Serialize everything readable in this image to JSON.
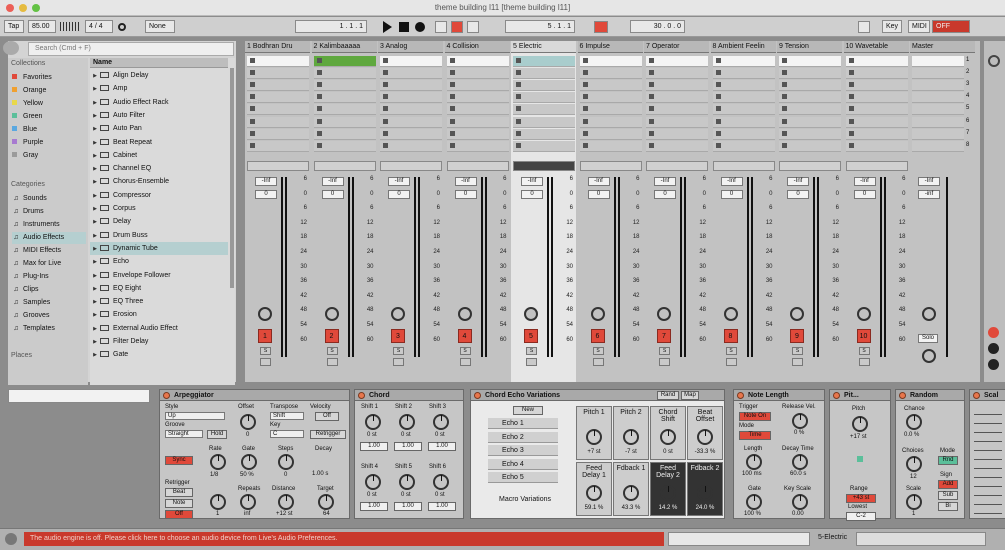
{
  "window": {
    "title": "theme building l11  [theme building l11]"
  },
  "control_bar": {
    "tap": "Tap",
    "tempo": "85.00",
    "time_sig": "4 / 4",
    "metronome": "1 Bar",
    "quantize": "None",
    "position": "1 .  1 .  1",
    "loop_start": "5 .  1 .  1",
    "loop_length": "30 .  0 .  0",
    "key_label": "Key",
    "midi_label": "MIDI",
    "cpu": "OFF"
  },
  "browser": {
    "search_placeholder": "Search (Cmd + F)",
    "collections_header": "Collections",
    "collections": [
      {
        "label": "Favorites",
        "color": "#e0493a"
      },
      {
        "label": "Orange",
        "color": "#f0a030"
      },
      {
        "label": "Yellow",
        "color": "#e8d84a"
      },
      {
        "label": "Green",
        "color": "#5bbf9a"
      },
      {
        "label": "Blue",
        "color": "#5aa8e0"
      },
      {
        "label": "Purple",
        "color": "#a77ad0"
      },
      {
        "label": "Gray",
        "color": "#9a9a9a"
      }
    ],
    "categories_header": "Categories",
    "categories": [
      "Sounds",
      "Drums",
      "Instruments",
      "Audio Effects",
      "MIDI Effects",
      "Max for Live",
      "Plug-Ins",
      "Clips",
      "Samples",
      "Grooves",
      "Templates"
    ],
    "places_header": "Places",
    "name_header": "Name",
    "items": [
      "Align Delay",
      "Amp",
      "Audio Effect Rack",
      "Auto Filter",
      "Auto Pan",
      "Beat Repeat",
      "Cabinet",
      "Channel EQ",
      "Chorus-Ensemble",
      "Compressor",
      "Corpus",
      "Delay",
      "Drum Buss",
      "Dynamic Tube",
      "Echo",
      "Envelope Follower",
      "EQ Eight",
      "EQ Three",
      "Erosion",
      "External Audio Effect",
      "Filter Delay",
      "Gate"
    ]
  },
  "tracks": [
    {
      "name": "1 Bodhran Dru",
      "num": "1",
      "vol": "-Inf",
      "send": "0"
    },
    {
      "name": "2 Kalimbaaaaa",
      "num": "2",
      "vol": "-Inf",
      "send": "0"
    },
    {
      "name": "3 Analog",
      "num": "3",
      "vol": "-Inf",
      "send": "0"
    },
    {
      "name": "4 Collision",
      "num": "4",
      "vol": "-Inf",
      "send": "0"
    },
    {
      "name": "5 Electric",
      "num": "5",
      "vol": "-Inf",
      "send": "0"
    },
    {
      "name": "6 Impulse",
      "num": "6",
      "vol": "-Inf",
      "send": "0"
    },
    {
      "name": "7 Operator",
      "num": "7",
      "vol": "-Inf",
      "send": "0"
    },
    {
      "name": "8 Ambient Feelin",
      "num": "8",
      "vol": "-Inf",
      "send": "0"
    },
    {
      "name": "9 Tension",
      "num": "9",
      "vol": "-Inf",
      "send": "0"
    },
    {
      "name": "10 Wavetable",
      "num": "10",
      "vol": "-Inf",
      "send": "0"
    }
  ],
  "master": {
    "name": "Master",
    "vol": "-Inf",
    "send": "-inf",
    "solo": "Solo",
    "scenes": [
      "1",
      "2",
      "3",
      "4",
      "5",
      "6",
      "7",
      "8"
    ]
  },
  "db_scale": [
    "6",
    "0",
    "6",
    "12",
    "18",
    "24",
    "30",
    "36",
    "42",
    "48",
    "54",
    "60"
  ],
  "devices": {
    "arp": {
      "title": "Arpeggiator",
      "style": "Style",
      "style_val": "Up",
      "groove": "Groove",
      "groove_val": "Straight",
      "hold": "Hold",
      "offset": "Offset",
      "offset_val": "0",
      "transpose": "Transpose",
      "transpose_val": "Shift",
      "key": "Key",
      "key_val": "C",
      "velocity": "Velocity",
      "velocity_val": "Off",
      "retrigger_btn": "Retrigger",
      "sync": "Sync",
      "rate": "Rate",
      "rate_val": "1/8",
      "gate": "Gate",
      "gate_val": "50 %",
      "steps": "Steps",
      "steps_val": "0",
      "decay": "Decay",
      "decay_val": "1.00 s",
      "retrigger": "Retrigger",
      "beat": "Beat",
      "note": "Note",
      "off": "Off",
      "repeats": "Repeats",
      "repeats_val": "inf",
      "repeats_knob": "1",
      "distance": "Distance",
      "distance_val": "+12 st",
      "target": "Target",
      "target_val": "64"
    },
    "chord": {
      "title": "Chord",
      "shifts": [
        "Shift 1",
        "Shift 2",
        "Shift 3",
        "Shift 4",
        "Shift 5",
        "Shift 6"
      ],
      "vals": [
        "0 st",
        "0 st",
        "0 st",
        "0 st",
        "0 st",
        "0 st"
      ],
      "vel": [
        "1.00",
        "1.00",
        "1.00",
        "1.00",
        "1.00",
        "1.00"
      ]
    },
    "cev": {
      "title": "Chord Echo Variations",
      "rand": "Rand",
      "map": "Map",
      "new_btn": "New",
      "echoes": [
        "Echo 1",
        "Echo 2",
        "Echo 3",
        "Echo 4",
        "Echo 5"
      ],
      "macro_variations": "Macro Variations",
      "macros": [
        {
          "label": "Pitch 1",
          "val": "+7 st"
        },
        {
          "label": "Pitch 2",
          "val": "-7 st"
        },
        {
          "label": "Chord Shift",
          "val": "0 st"
        },
        {
          "label": "Beat Offset",
          "val": "-33.3 %"
        },
        {
          "label": "Feed Delay 1",
          "val": "59.1 %"
        },
        {
          "label": "Fdback 1",
          "val": "43.3 %"
        },
        {
          "label": "Feed Delay 2",
          "val": "14.2 %"
        },
        {
          "label": "Fdback 2",
          "val": "24.0 %"
        }
      ]
    },
    "note_length": {
      "title": "Note Length",
      "trigger": "Trigger",
      "trigger_val": "Note On",
      "mode": "Mode",
      "mode_val": "Time",
      "release_vel": "Release Vel.",
      "release_vel_val": "0 %",
      "length": "Length",
      "length_val": "100 ms",
      "decay_time": "Decay Time",
      "decay_time_val": "60.0 s",
      "gate": "Gate",
      "gate_val": "100 %",
      "key_scale": "Key Scale",
      "key_scale_val": "0.00"
    },
    "pitch": {
      "title": "Pit...",
      "pitch": "Pitch",
      "pitch_val": "+17 st",
      "range": "Range",
      "range_val": "+43 st",
      "lowest": "Lowest",
      "lowest_val": "C-2"
    },
    "random": {
      "title": "Random",
      "chance": "Chance",
      "chance_val": "0.0 %",
      "choices": "Choices",
      "choices_val": "12",
      "scale": "Scale",
      "scale_val": "1",
      "mode": "Mode",
      "mode_val": "Rnd",
      "sign": "Sign",
      "add": "Add",
      "sub": "Sub",
      "bi": "Bi"
    },
    "scale": {
      "title": "Scal"
    }
  },
  "status": {
    "message": "The audio engine is off. Please click here to choose an audio device from Live's Audio Preferences.",
    "track_name": "5-Electric"
  }
}
